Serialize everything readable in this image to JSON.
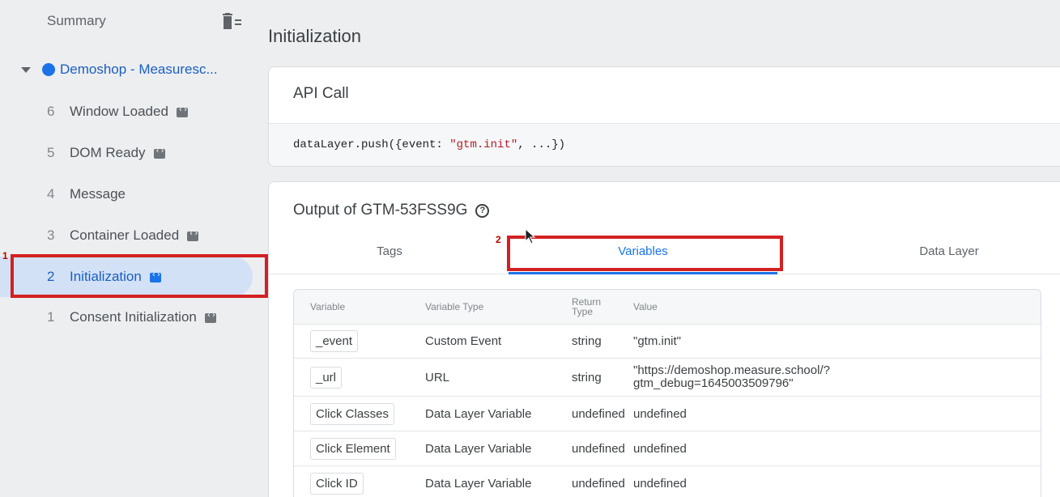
{
  "sidebar": {
    "summary": "Summary",
    "container": "Demoshop - Measuresc...",
    "events": [
      {
        "num": "6",
        "label": "Window Loaded",
        "badge": true
      },
      {
        "num": "5",
        "label": "DOM Ready",
        "badge": true
      },
      {
        "num": "4",
        "label": "Message",
        "badge": false
      },
      {
        "num": "3",
        "label": "Container Loaded",
        "badge": true
      },
      {
        "num": "2",
        "label": "Initialization",
        "badge": true
      },
      {
        "num": "1",
        "label": "Consent Initialization",
        "badge": true
      }
    ]
  },
  "annotations": {
    "marker1": "1",
    "marker2": "2"
  },
  "main": {
    "title": "Initialization",
    "api_call": {
      "heading": "API Call",
      "code_prefix": "dataLayer.push({event: ",
      "code_string": "\"gtm.init\"",
      "code_suffix": ", ...})"
    },
    "output": {
      "heading": "Output of GTM-53FSS9G",
      "help_glyph": "?",
      "tabs": [
        "Tags",
        "Variables",
        "Data Layer"
      ],
      "active_tab": "Variables"
    },
    "table": {
      "headers": {
        "variable": "Variable",
        "type": "Variable Type",
        "return_line1": "Return",
        "return_line2": "Type",
        "value": "Value"
      },
      "rows": [
        {
          "variable": "_event",
          "type": "Custom Event",
          "return": "string",
          "value": "\"gtm.init\""
        },
        {
          "variable": "_url",
          "type": "URL",
          "return": "string",
          "value_line1": "\"https://demoshop.measure.school/?",
          "value_line2": "gtm_debug=1645003509796\""
        },
        {
          "variable": "Click Classes",
          "type": "Data Layer Variable",
          "return": "undefined",
          "value": "undefined"
        },
        {
          "variable": "Click Element",
          "type": "Data Layer Variable",
          "return": "undefined",
          "value": "undefined"
        },
        {
          "variable": "Click ID",
          "type": "Data Layer Variable",
          "return": "undefined",
          "value": "undefined"
        }
      ]
    }
  },
  "colors": {
    "accent": "#1a73e8",
    "annotation": "#d32020",
    "selected_bg": "#d2e1f6"
  }
}
